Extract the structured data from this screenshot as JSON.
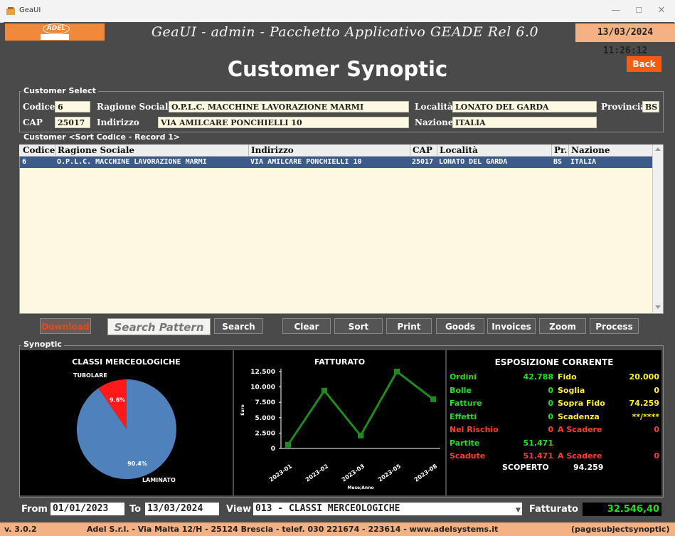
{
  "window": {
    "title": "GeaUI",
    "controls": [
      "—",
      "☐",
      "✕"
    ]
  },
  "banner": {
    "logo_text": "ADEL",
    "title": "GeaUI - admin - Pacchetto Applicativo GEADE Rel 6.0",
    "datetime": "13/03/2024 11:26:12"
  },
  "page": {
    "title": "Customer Synoptic",
    "back_label": "Back"
  },
  "customer_select": {
    "legend": "Customer Select",
    "codice_label": "Codice",
    "codice": "6",
    "ragione_sociale_label": "Ragione Sociale",
    "ragione_sociale": "O.P.L.C. MACCHINE LAVORAZIONE MARMI",
    "localita_label": "Località",
    "localita": "LONATO DEL GARDA",
    "provincia_label": "Provincia",
    "provincia": "BS",
    "cap_label": "CAP",
    "cap": "25017",
    "indirizzo_label": "Indirizzo",
    "indirizzo": "VIA AMILCARE PONCHIELLI 10",
    "nazione_label": "Nazione",
    "nazione": "ITALIA"
  },
  "customer_list": {
    "legend": "Customer <Sort Codice - Record 1>",
    "columns": [
      "Codice",
      "Ragione Sociale",
      "Indirizzo",
      "CAP",
      "Località",
      "Pr.",
      "Nazione"
    ],
    "rows": [
      [
        "6",
        "O.P.L.C. MACCHINE LAVORAZIONE MARMI",
        "VIA AMILCARE PONCHIELLI 10",
        "25017",
        "LONATO DEL GARDA",
        "BS",
        "ITALIA"
      ]
    ]
  },
  "toolbar": {
    "download": "Download",
    "search_pattern": "Search Pattern",
    "search": "Search",
    "clear": "Clear",
    "sort": "Sort",
    "print": "Print",
    "goods": "Goods",
    "invoices": "Invoices",
    "zoom": "Zoom",
    "process": "Process"
  },
  "synoptic": {
    "legend": "Synoptic",
    "pie_title": "CLASSI MERCEOLOGICHE",
    "line_title": "FATTURATO",
    "line_ylabel": "Euro",
    "line_xlabel": "Mese/Anno",
    "exposure_title": "ESPOSIZIONE CORRENTE",
    "exposure_left": [
      {
        "label": "Ordini",
        "value": "42.788",
        "color": "green"
      },
      {
        "label": "Bolle",
        "value": "0",
        "color": "green"
      },
      {
        "label": "Fatture",
        "value": "0",
        "color": "green"
      },
      {
        "label": "Effetti",
        "value": "0",
        "color": "green"
      },
      {
        "label": "Nel Rischio",
        "value": "0",
        "color": "red"
      },
      {
        "label": "Partite",
        "value": "51.471",
        "color": "green"
      },
      {
        "label": "Scadute",
        "value": "51.471",
        "color": "red"
      }
    ],
    "exposure_right": [
      {
        "label": "Fido",
        "value": "20.000",
        "color": "yellow"
      },
      {
        "label": "Soglia",
        "value": "0",
        "color": "yellow"
      },
      {
        "label": "Sopra Fido",
        "value": "74.259",
        "color": "yellow"
      },
      {
        "label": "Scadenza",
        "value": "**/****",
        "color": "yellow"
      },
      {
        "label": "A Scadere",
        "value": "0",
        "color": "red"
      },
      {
        "label": "A Scadere",
        "value": "0",
        "color": "red"
      }
    ],
    "scoperto_label": "SCOPERTO",
    "scoperto_value": "94.259"
  },
  "chart_data": [
    {
      "type": "pie",
      "title": "CLASSI MERCEOLOGICHE",
      "slices": [
        {
          "name": "LAMINATO",
          "value": 90.4,
          "label": "90.4%",
          "color": "#4f81bd"
        },
        {
          "name": "TUBOLARE",
          "value": 9.6,
          "label": "9.6%",
          "color": "#ff1a1a"
        }
      ]
    },
    {
      "type": "line",
      "title": "FATTURATO",
      "xlabel": "Mese/Anno",
      "ylabel": "Euro",
      "categories": [
        "2023-01",
        "2023-02",
        "2023-03",
        "2023-05",
        "2023-08"
      ],
      "series": [
        {
          "values": [
            600,
            9400,
            2100,
            12500,
            8000
          ],
          "color": "#1f8a1f"
        }
      ],
      "ylim": [
        0,
        12500
      ],
      "yticks": [
        0,
        2500,
        5000,
        7500,
        10000,
        12500
      ],
      "ytick_labels": [
        "0",
        "2.500",
        "5.000",
        "7.500",
        "10.000",
        "12.500"
      ],
      "grid": false
    }
  ],
  "filters": {
    "from_label": "From",
    "from": "01/01/2023",
    "to_label": "To",
    "to": "13/03/2024",
    "view_label": "View",
    "view": "013 - CLASSI MERCEOLOGICHE",
    "fatturato_label": "Fatturato",
    "fatturato": "32.546,40"
  },
  "footer": {
    "version": "v. 3.0.2",
    "company": "Adel S.r.l. - Via Malta 12/H - 25124 Brescia - telef. 030 221674 - 223614 - www.adelsystems.it",
    "page_id": "(pagesubjectsynoptic)"
  }
}
